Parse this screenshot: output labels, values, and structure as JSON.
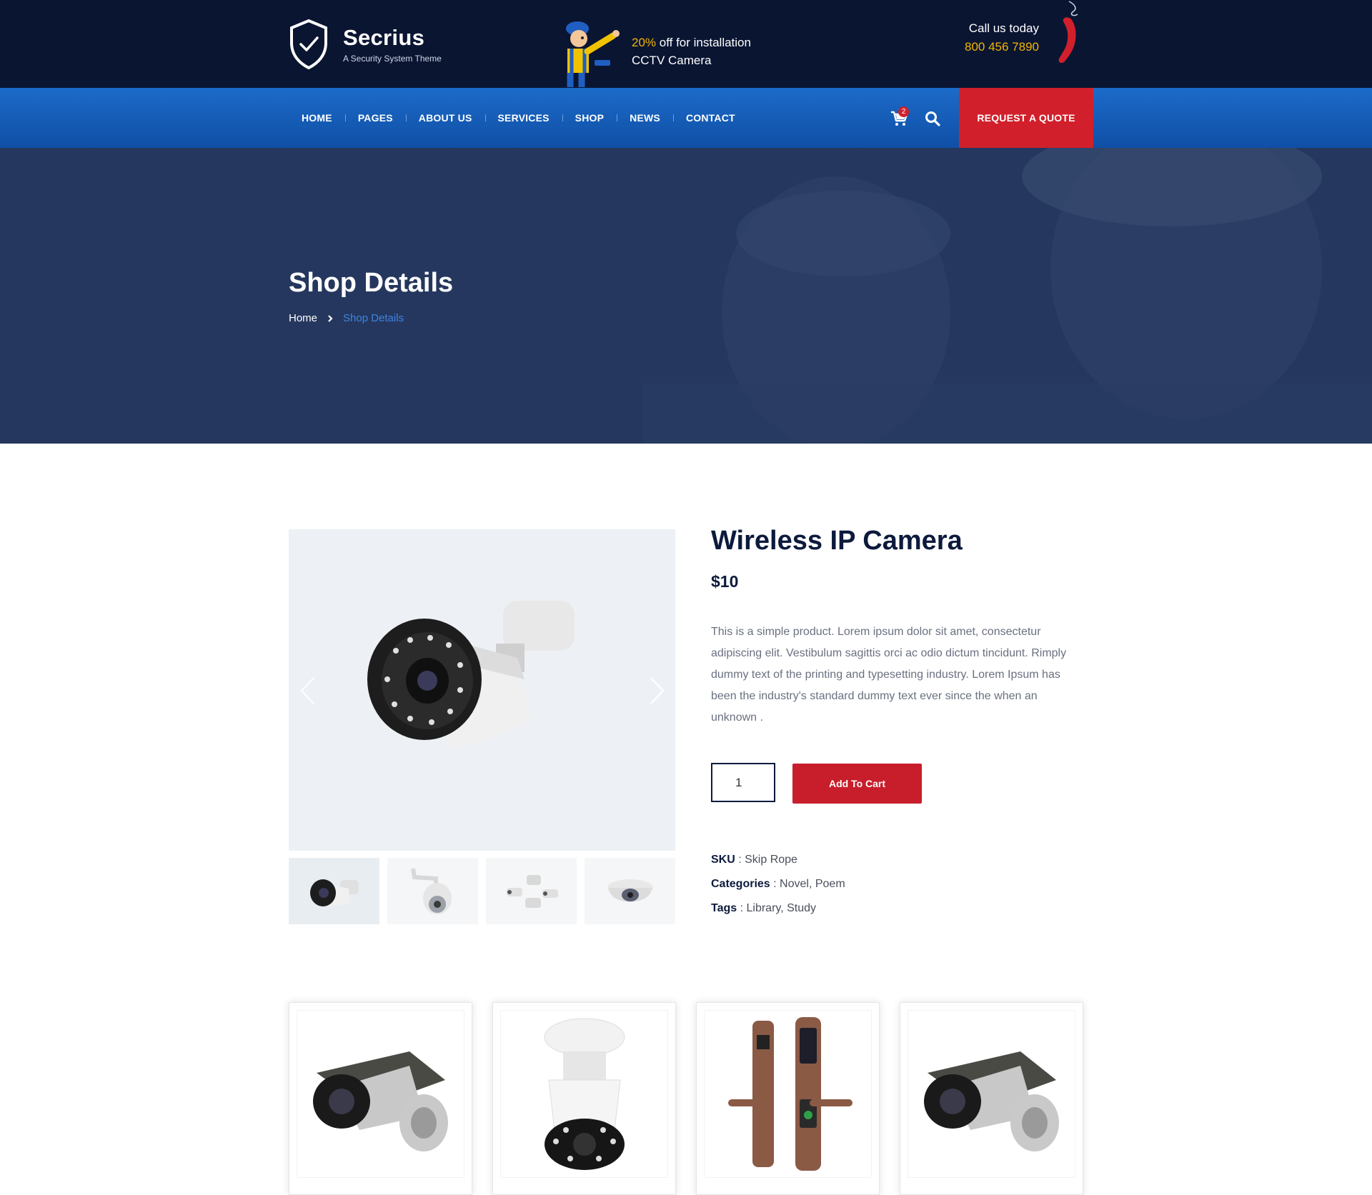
{
  "brand": {
    "name": "Secrius",
    "tagline": "A Security System Theme"
  },
  "promo": {
    "highlight": "20%",
    "line1_rest": " off for installation",
    "line2": "CCTV Camera"
  },
  "call": {
    "label": "Call us today",
    "phone": "800 456 7890"
  },
  "nav": {
    "items": [
      "HOME",
      "PAGES",
      "ABOUT US",
      "SERVICES",
      "SHOP",
      "NEWS",
      "CONTACT"
    ],
    "cart_count": "2",
    "quote_label": "REQUEST A QUOTE"
  },
  "banner": {
    "title": "Shop Details",
    "breadcrumb_home": "Home",
    "breadcrumb_current": "Shop Details"
  },
  "product": {
    "title": "Wireless IP Camera",
    "price": "$10",
    "description": "This is a simple product. Lorem ipsum dolor sit amet, consectetur adipiscing elit. Vestibulum sagittis orci ac odio dictum tincidunt. Rimply dummy text of the printing and typesetting industry. Lorem Ipsum has been the industry's standard dummy text ever since the when an unknown .",
    "quantity": "1",
    "add_to_cart": "Add To Cart",
    "sku_label": "SKU",
    "sku": "Skip Rope",
    "categories_label": "Categories",
    "categories": "Novel, Poem",
    "tags_label": "Tags",
    "tags": "Library, Study"
  },
  "colors": {
    "topbar": "#0a1532",
    "nav": "#1c6bc8",
    "accent_red": "#d1202b",
    "highlight": "#f2b500",
    "heading": "#0c1a3c"
  }
}
